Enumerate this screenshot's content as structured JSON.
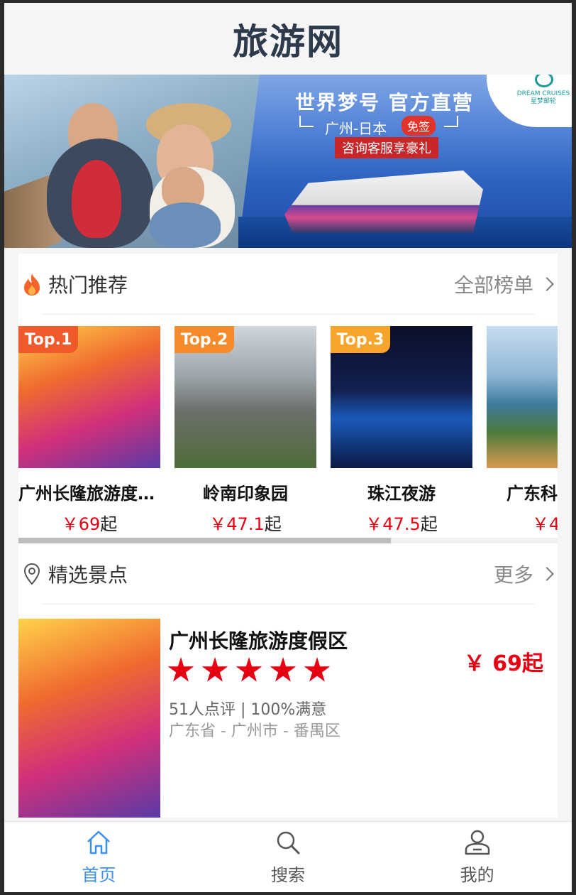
{
  "header": {
    "title": "旅游网"
  },
  "banner": {
    "headline": "世界梦号 官方直营",
    "route": "广州-日本",
    "free_badge": "免签",
    "consult": "咨询客服享豪礼",
    "brand_en": "DREAM CRUISES",
    "brand_cn": "星梦邮轮"
  },
  "hot": {
    "title": "热门推荐",
    "more": "全部榜单",
    "icon": "fire-icon",
    "items": [
      {
        "badge": "Top.1",
        "badge_color": "#f05a2a",
        "name": "广州长隆旅游度假区",
        "price": "￥69",
        "suffix": "起"
      },
      {
        "badge": "Top.2",
        "badge_color": "#f58a2a",
        "name": "岭南印象园",
        "price": "￥47.1",
        "suffix": "起"
      },
      {
        "badge": "Top.3",
        "badge_color": "#f7a52a",
        "name": "珠江夜游",
        "price": "￥47.5",
        "suffix": "起"
      },
      {
        "badge": "",
        "badge_color": "",
        "name": "广东科",
        "price": "￥4",
        "suffix": ""
      }
    ]
  },
  "featured": {
    "title": "精选景点",
    "more": "更多",
    "icon": "location-pin-icon",
    "item": {
      "name": "广州长隆旅游度假区",
      "rating": 5,
      "reviews": "51人点评 | 100%满意",
      "area": "广东省 - 广州市 - 番禺区",
      "price": "￥ 69起"
    }
  },
  "tabbar": {
    "active_color": "#3b8ff0",
    "tabs": [
      {
        "label": "首页",
        "icon": "home-icon"
      },
      {
        "label": "搜索",
        "icon": "search-icon"
      },
      {
        "label": "我的",
        "icon": "user-icon"
      }
    ]
  }
}
